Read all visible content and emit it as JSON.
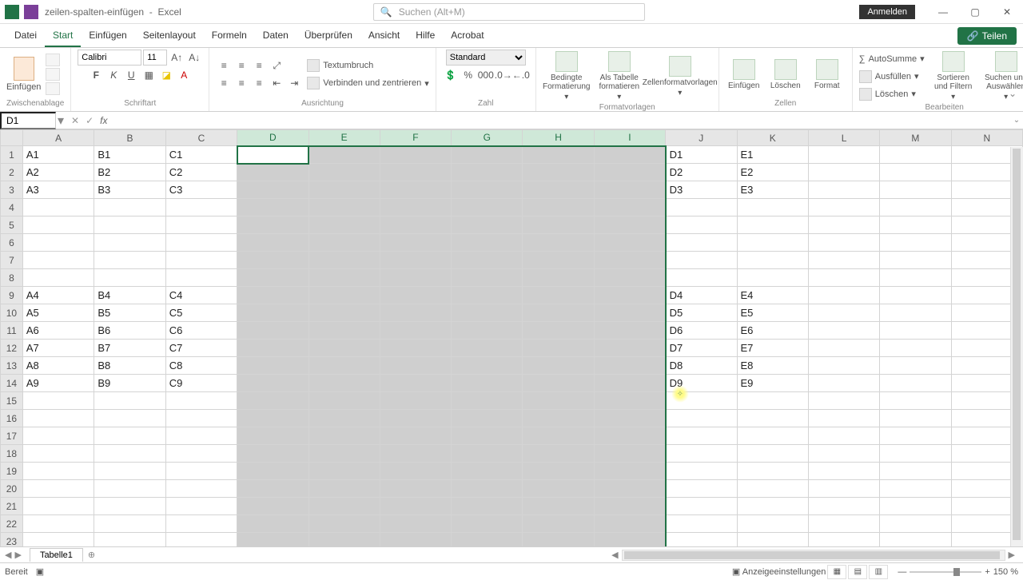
{
  "title": {
    "filename": "zeilen-spalten-einfügen",
    "app": "Excel"
  },
  "search_placeholder": "Suchen (Alt+M)",
  "login": "Anmelden",
  "tabs": [
    "Datei",
    "Start",
    "Einfügen",
    "Seitenlayout",
    "Formeln",
    "Daten",
    "Überprüfen",
    "Ansicht",
    "Hilfe",
    "Acrobat"
  ],
  "active_tab": "Start",
  "share": "Teilen",
  "ribbon": {
    "clipboard": {
      "paste": "Einfügen",
      "label": "Zwischenablage"
    },
    "font": {
      "name": "Calibri",
      "size": "11",
      "label": "Schriftart"
    },
    "align": {
      "wrap": "Textumbruch",
      "merge": "Verbinden und zentrieren",
      "label": "Ausrichtung"
    },
    "number": {
      "format": "Standard",
      "label": "Zahl"
    },
    "styles": {
      "cond": "Bedingte Formatierung",
      "table": "Als Tabelle formatieren",
      "cell": "Zellenformatvorlagen",
      "label": "Formatvorlagen"
    },
    "cells": {
      "insert": "Einfügen",
      "delete": "Löschen",
      "format": "Format",
      "label": "Zellen"
    },
    "editing": {
      "sum": "AutoSumme",
      "fill": "Ausfüllen",
      "clear": "Löschen",
      "sort": "Sortieren und Filtern",
      "find": "Suchen und Auswählen",
      "label": "Bearbeiten"
    }
  },
  "namebox": "D1",
  "columns": [
    "A",
    "B",
    "C",
    "D",
    "E",
    "F",
    "G",
    "H",
    "I",
    "J",
    "K",
    "L",
    "M",
    "N"
  ],
  "selected_cols": [
    "D",
    "E",
    "F",
    "G",
    "H",
    "I"
  ],
  "row_count": 23,
  "cells": {
    "1": {
      "A": "A1",
      "B": "B1",
      "C": "C1",
      "J": "D1",
      "K": "E1"
    },
    "2": {
      "A": "A2",
      "B": "B2",
      "C": "C2",
      "J": "D2",
      "K": "E2"
    },
    "3": {
      "A": "A3",
      "B": "B3",
      "C": "C3",
      "J": "D3",
      "K": "E3"
    },
    "9": {
      "A": "A4",
      "B": "B4",
      "C": "C4",
      "J": "D4",
      "K": "E4"
    },
    "10": {
      "A": "A5",
      "B": "B5",
      "C": "C5",
      "J": "D5",
      "K": "E5"
    },
    "11": {
      "A": "A6",
      "B": "B6",
      "C": "C6",
      "J": "D6",
      "K": "E6"
    },
    "12": {
      "A": "A7",
      "B": "B7",
      "C": "C7",
      "J": "D7",
      "K": "E7"
    },
    "13": {
      "A": "A8",
      "B": "B8",
      "C": "C8",
      "J": "D8",
      "K": "E8"
    },
    "14": {
      "A": "A9",
      "B": "B9",
      "C": "C9",
      "J": "D9",
      "K": "E9"
    }
  },
  "sheet_tab": "Tabelle1",
  "status": {
    "ready": "Bereit",
    "display": "Anzeigeeinstellungen",
    "zoom": "150 %"
  }
}
